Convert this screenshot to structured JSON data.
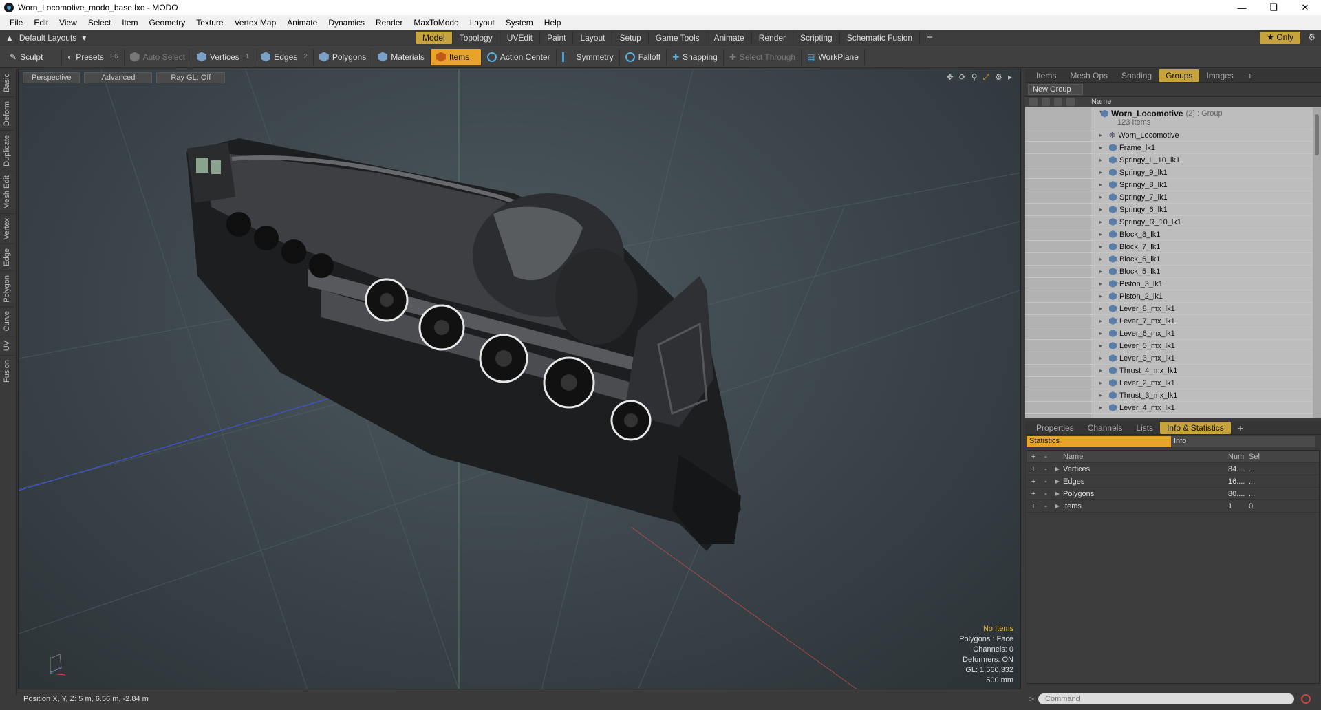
{
  "window": {
    "title": "Worn_Locomotive_modo_base.lxo - MODO",
    "controls": [
      "minimize-icon",
      "restore-icon",
      "close-icon"
    ]
  },
  "menu": [
    "File",
    "Edit",
    "View",
    "Select",
    "Item",
    "Geometry",
    "Texture",
    "Vertex Map",
    "Animate",
    "Dynamics",
    "Render",
    "MaxToModo",
    "Layout",
    "System",
    "Help"
  ],
  "layoutbar": {
    "layout_dropdown": "Default Layouts",
    "tabs": [
      "Model",
      "Topology",
      "UVEdit",
      "Paint",
      "Layout",
      "Setup",
      "Game Tools",
      "Animate",
      "Render",
      "Scripting",
      "Schematic Fusion"
    ],
    "active_tab": "Model",
    "only_label": "Only"
  },
  "toolbar": {
    "sculpt": "Sculpt",
    "presets": "Presets",
    "presets_key": "F6",
    "auto_select": "Auto Select",
    "vertices": "Vertices",
    "vertices_key": "1",
    "edges": "Edges",
    "edges_key": "2",
    "polygons": "Polygons",
    "materials": "Materials",
    "items": "Items",
    "action_center": "Action Center",
    "symmetry": "Symmetry",
    "falloff": "Falloff",
    "snapping": "Snapping",
    "select_through": "Select Through",
    "workplane": "WorkPlane"
  },
  "lefttabs": [
    "Basic",
    "Deform",
    "Duplicate",
    "Mesh Edit",
    "Vertex",
    "Edge",
    "Polygon",
    "Curve",
    "UV",
    "Fusion"
  ],
  "viewport": {
    "view_mode": "Perspective",
    "shading": "Advanced",
    "raygl": "Ray GL: Off",
    "stats": {
      "selection": "No Items",
      "polygons": "Polygons : Face",
      "channels": "Channels: 0",
      "deformers": "Deformers: ON",
      "gl": "GL: 1,560,332",
      "scale": "500 mm"
    }
  },
  "status": {
    "position": "Position X, Y, Z:   5 m, 6.56 m, -2.84 m"
  },
  "upper_panel": {
    "tabs": [
      "Items",
      "Mesh Ops",
      "Shading",
      "Groups",
      "Images"
    ],
    "active_tab": "Groups",
    "new_group": "New Group",
    "column_name": "Name",
    "group_name": "Worn_Locomotive",
    "group_suffix": "(2) : Group",
    "group_count": "123 Items",
    "items": [
      "Worn_Locomotive",
      "Frame_lk1",
      "Springy_L_10_lk1",
      "Springy_9_lk1",
      "Springy_8_lk1",
      "Springy_7_lk1",
      "Springy_6_lk1",
      "Springy_R_10_lk1",
      "Block_8_lk1",
      "Block_7_lk1",
      "Block_6_lk1",
      "Block_5_lk1",
      "Piston_3_lk1",
      "Piston_2_lk1",
      "Lever_8_mx_lk1",
      "Lever_7_mx_lk1",
      "Lever_6_mx_lk1",
      "Lever_5_mx_lk1",
      "Lever_3_mx_lk1",
      "Thrust_4_mx_lk1",
      "Lever_2_mx_lk1",
      "Thrust_3_mx_lk1",
      "Lever_4_mx_lk1"
    ]
  },
  "lower_panel": {
    "tabs": [
      "Properties",
      "Channels",
      "Lists",
      "Info & Statistics"
    ],
    "active_tab": "Info & Statistics",
    "sub_tabs": [
      "Statistics",
      "Info"
    ],
    "columns": [
      "Name",
      "Num",
      "Sel"
    ],
    "rows": [
      {
        "name": "Vertices",
        "num": "84....",
        "sel": "..."
      },
      {
        "name": "Edges",
        "num": "16....",
        "sel": "..."
      },
      {
        "name": "Polygons",
        "num": "80....",
        "sel": "..."
      },
      {
        "name": "Items",
        "num": "1",
        "sel": "0"
      }
    ]
  },
  "command": {
    "placeholder": "Command"
  },
  "colors": {
    "accent": "#e8a32a",
    "tab_active": "#c6a33c"
  }
}
